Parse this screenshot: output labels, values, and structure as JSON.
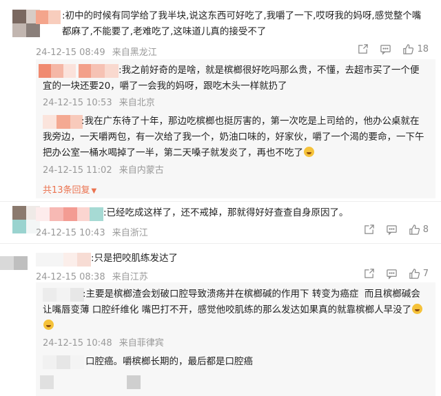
{
  "comments": [
    {
      "text": ":初中的时候有同学给了我半块,说这东西可好吃了,我嚼了一下,哎呀我的妈呀,感觉整个嘴都麻了,不能要了,老难吃了,这味道儿真的接受不了",
      "time": "24-12-15 08:49",
      "location": "来自黑龙江",
      "likes": "18"
    },
    {
      "text": ":已经吃成这样了，还不戒掉，那就得好好查查自身原因了。",
      "time": "24-12-15 10:43",
      "location": "来自浙江",
      "likes": "8"
    },
    {
      "text": ":只是把咬肌练发达了",
      "time": "24-12-15 08:38",
      "location": "来自江苏",
      "likes": "7"
    }
  ],
  "replies": [
    {
      "text": ":我之前好奇的是啥，就是槟榔很好吃吗那么贵，不懂，去超市买了一个便宜的一块还要20，嚼了一会我的妈呀，跟吃木头一样就扔了",
      "time": "24-12-15 10:53",
      "location": "来自北京"
    },
    {
      "text": ":我在广东待了十年，那边吃槟榔也挺厉害的，第一次吃是上司给的，他办公桌就在我旁边，一天嚼两包，有一次给了我一个，奶油口味的，好家伙，嚼了一个渴的要命，一下午把办公室一桶水喝掉了一半，第二天嗓子就发炎了，再也不吃了",
      "time": "24-12-15 11:02",
      "location": "来自内蒙古",
      "emoji": "laugh-cry-emoji"
    },
    {
      "text": ":主要是槟榔渣会划破口腔导致溃疡并在槟榔碱的作用下 转变为癌症  而且槟榔碱会让嘴唇变薄 口腔纤维化 嘴巴打不开，感觉他咬肌练的那么发达如果真的就靠槟榔人早没了",
      "time": "24-12-15 10:48",
      "location": "来自菲律宾",
      "emoji": "laugh-cry-emoji"
    },
    {
      "text": "口腔癌。嚼槟榔长期的，最后都是口腔癌"
    }
  ],
  "expand_label": "共13条回复",
  "colors": {
    "accent": "#eb7350",
    "meta": "#999999",
    "reply_bg": "#f7f7f7"
  }
}
